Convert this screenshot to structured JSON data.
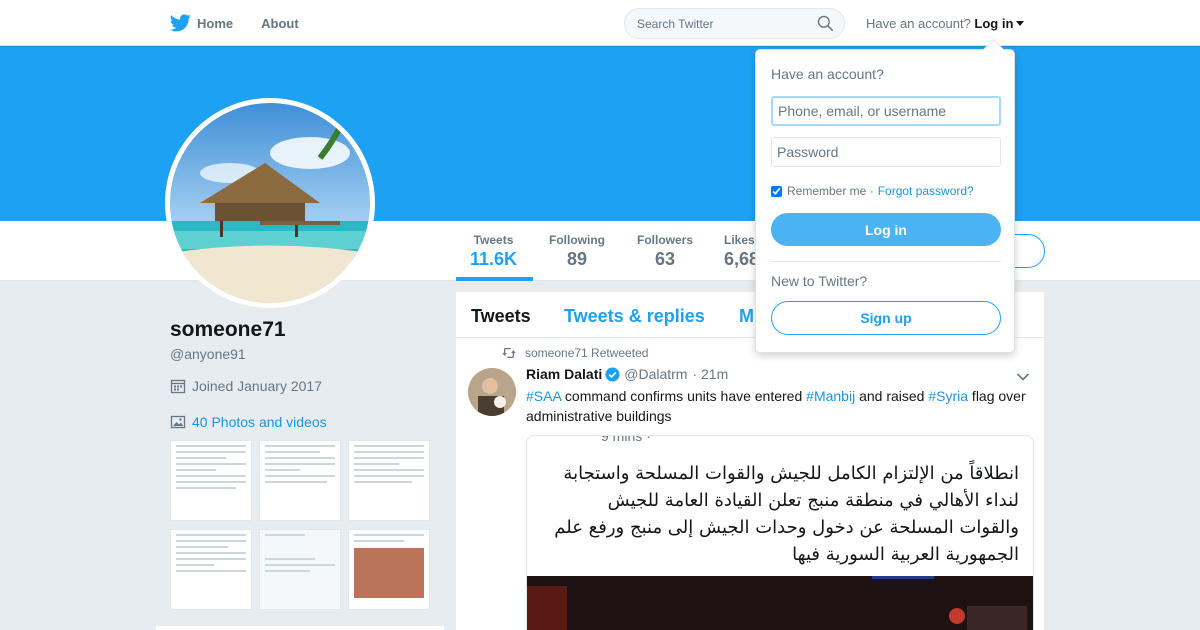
{
  "nav": {
    "home_label": "Home",
    "about_label": "About",
    "search_placeholder": "Search Twitter",
    "have_account": "Have an account?",
    "login_label": "Log in"
  },
  "profile": {
    "name": "someone71",
    "handle": "@anyone91",
    "joined": "Joined January 2017",
    "photos_link": "40 Photos and videos"
  },
  "stats": [
    {
      "label": "Tweets",
      "value": "11.6K"
    },
    {
      "label": "Following",
      "value": "89"
    },
    {
      "label": "Followers",
      "value": "63"
    },
    {
      "label": "Likes",
      "value": "6,68"
    }
  ],
  "timeline": {
    "tabs": [
      "Tweets",
      "Tweets & replies",
      "M"
    ]
  },
  "tweet": {
    "retweeted_by": "someone71 Retweeted",
    "author_name": "Riam Dalati",
    "author_handle": "@Dalatrm",
    "time": "· 21m",
    "text_parts": [
      "#SAA",
      " command confirms units have entered ",
      "#Manbij",
      " and raised ",
      "#Syria",
      " flag over administrative buildings"
    ],
    "quote_time": "9 mins ·",
    "quote_text": "انطلاقاً من الإلتزام الكامل للجيش والقوات المسلحة واستجابة لنداء الأهالي في منطقة منبج تعلن القيادة العامة للجيش والقوات المسلحة عن دخول وحدات الجيش إلى منبج ورفع علم الجمهورية العربية السورية فيها"
  },
  "login_dropdown": {
    "title": "Have an account?",
    "username_placeholder": "Phone, email, or username",
    "password_placeholder": "Password",
    "remember_label": "Remember me ·",
    "forgot_label": "Forgot password?",
    "login_button": "Log in",
    "new_label": "New to Twitter?",
    "signup_button": "Sign up",
    "remember_checked": true
  },
  "colors": {
    "brand": "#1da1f2",
    "link": "#1b95e0",
    "page_bg": "#e6ecf0"
  }
}
